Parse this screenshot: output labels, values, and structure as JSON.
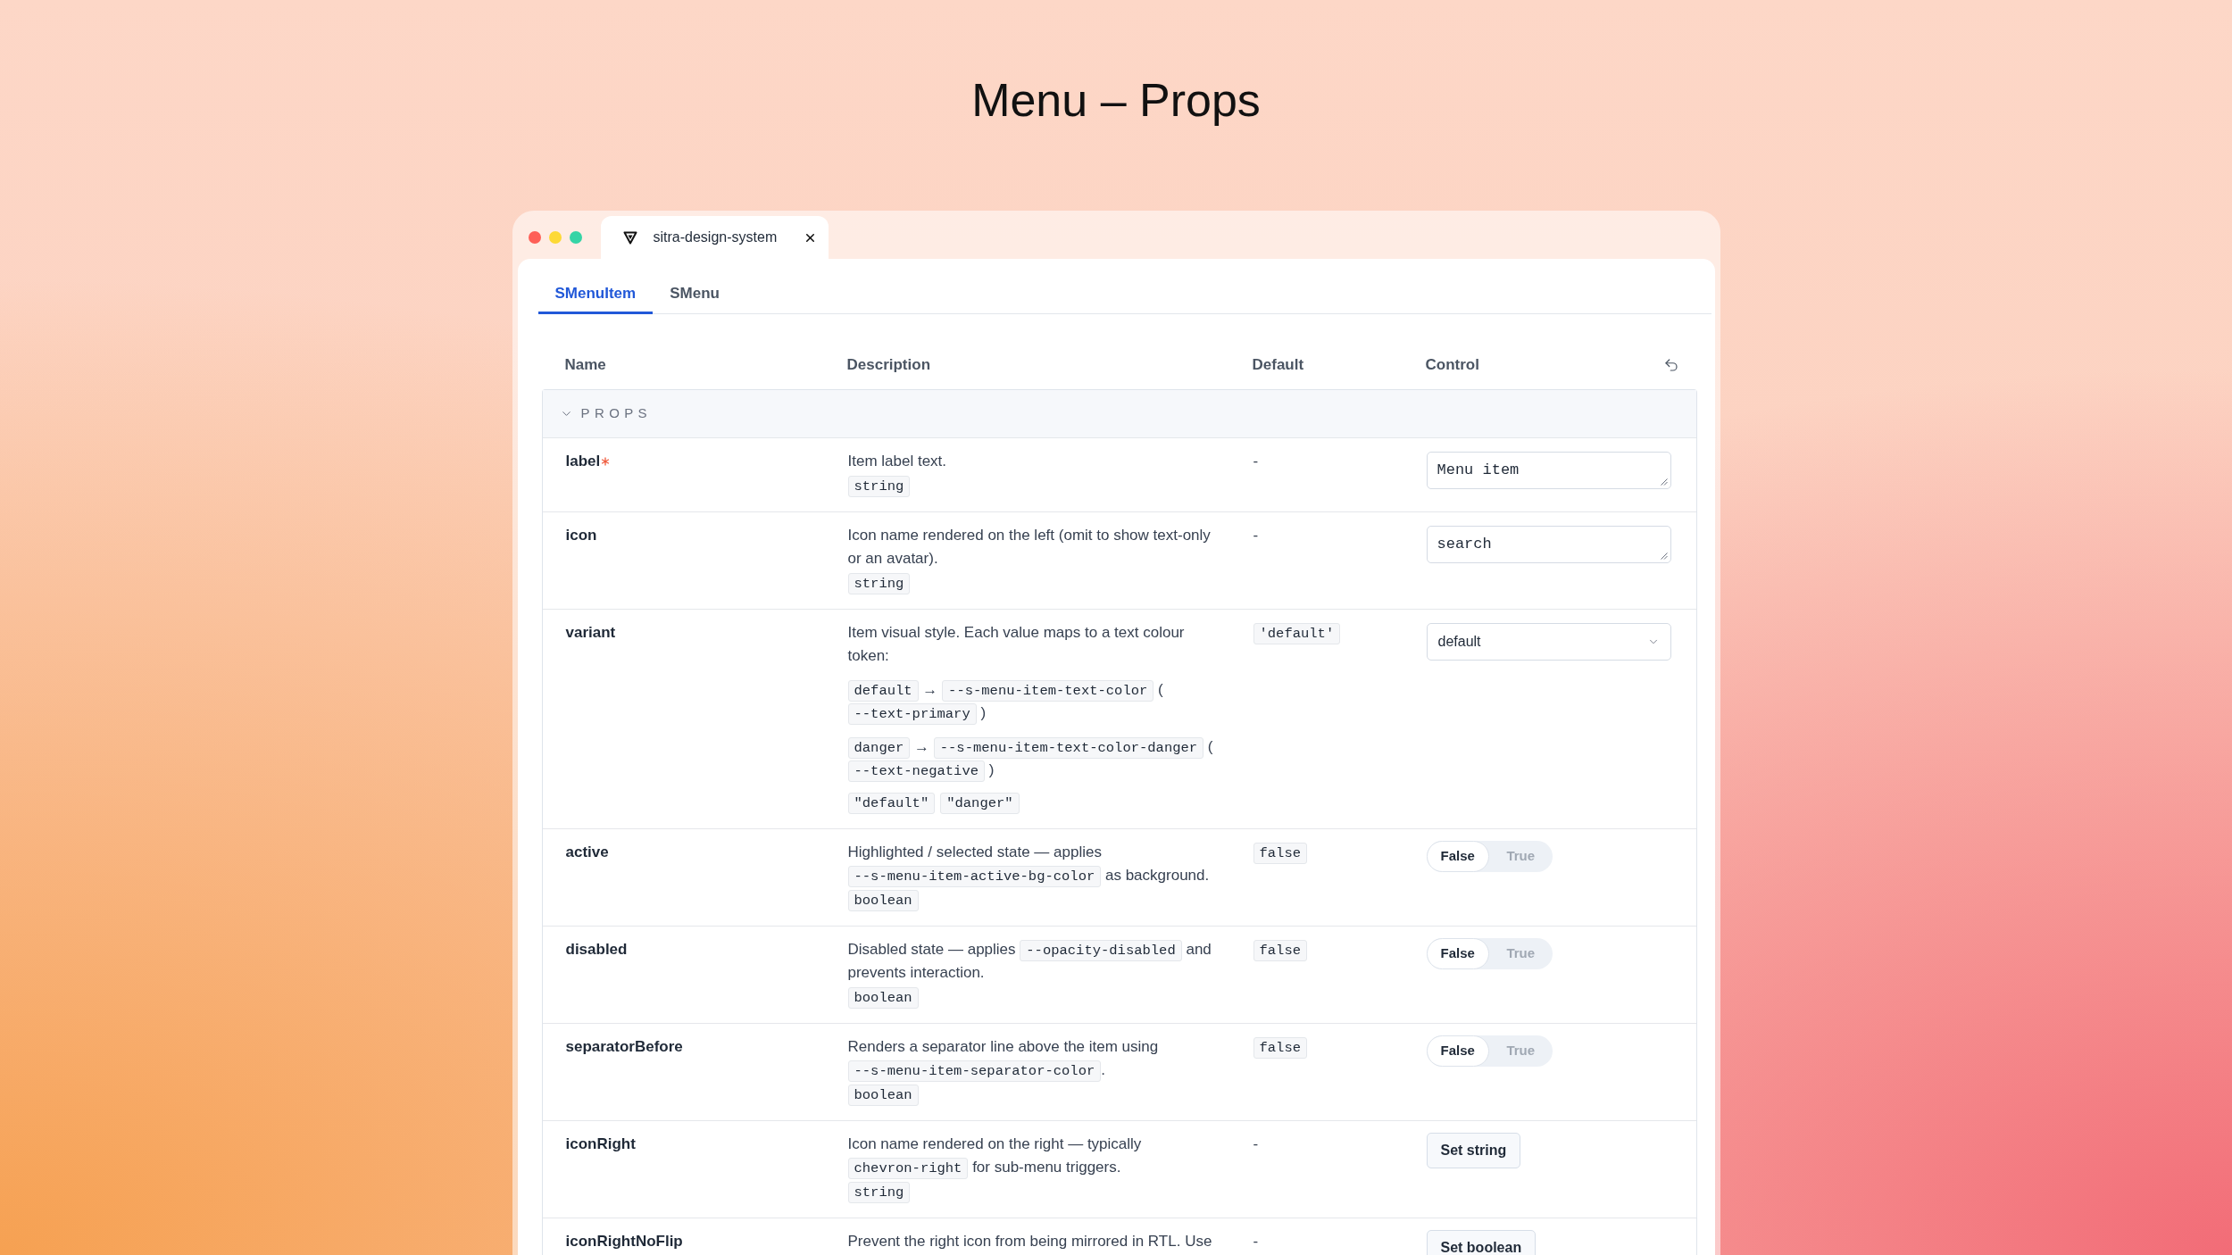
{
  "page_title": "Menu – Props",
  "browser_tab": {
    "title": "sitra-design-system"
  },
  "component_tabs": [
    {
      "label": "SMenuItem",
      "selected": true
    },
    {
      "label": "SMenu",
      "selected": false
    }
  ],
  "table": {
    "columns": [
      "Name",
      "Description",
      "Default",
      "Control"
    ],
    "section": {
      "title": "PROPS",
      "expanded": true
    },
    "rows": [
      {
        "name": "label",
        "required": true,
        "description": [
          {
            "kind": "text",
            "segments": [
              {
                "kind": "text",
                "text": "Item label text."
              }
            ]
          }
        ],
        "types": [
          "string"
        ],
        "default": {
          "kind": "text",
          "text": "-"
        },
        "control": {
          "kind": "textarea",
          "value": "Menu item"
        }
      },
      {
        "name": "icon",
        "required": false,
        "description": [
          {
            "kind": "text",
            "segments": [
              {
                "kind": "text",
                "text": "Icon name rendered on the left (omit to show text-only or an avatar)."
              }
            ]
          }
        ],
        "types": [
          "string"
        ],
        "default": {
          "kind": "text",
          "text": "-"
        },
        "control": {
          "kind": "textarea",
          "value": "search"
        }
      },
      {
        "name": "variant",
        "required": false,
        "description": [
          {
            "kind": "text",
            "segments": [
              {
                "kind": "text",
                "text": "Item visual style. Each value maps to a text colour token:"
              }
            ]
          },
          {
            "kind": "mapping",
            "segments": [
              {
                "kind": "code",
                "text": "default"
              },
              {
                "kind": "text",
                "text": " → "
              },
              {
                "kind": "code",
                "text": "--s-menu-item-text-color"
              },
              {
                "kind": "text",
                "text": " ( "
              },
              {
                "kind": "code",
                "text": "--text-primary"
              },
              {
                "kind": "text",
                "text": " )"
              }
            ]
          },
          {
            "kind": "mapping",
            "segments": [
              {
                "kind": "code",
                "text": "danger"
              },
              {
                "kind": "text",
                "text": " → "
              },
              {
                "kind": "code",
                "text": "--s-menu-item-text-color-danger"
              },
              {
                "kind": "text",
                "text": " ( "
              },
              {
                "kind": "code",
                "text": "--text-negative"
              },
              {
                "kind": "text",
                "text": " )"
              }
            ]
          }
        ],
        "types": [
          "\"default\"",
          "\"danger\""
        ],
        "default": {
          "kind": "code",
          "text": "'default'"
        },
        "control": {
          "kind": "select",
          "value": "default"
        }
      },
      {
        "name": "active",
        "required": false,
        "description": [
          {
            "kind": "text",
            "segments": [
              {
                "kind": "text",
                "text": "Highlighted / selected state — applies "
              },
              {
                "kind": "code",
                "text": "--s-menu-item-active-bg-color"
              },
              {
                "kind": "text",
                "text": " as background."
              }
            ]
          }
        ],
        "types": [
          "boolean"
        ],
        "default": {
          "kind": "code",
          "text": "false"
        },
        "control": {
          "kind": "toggle",
          "options": [
            {
              "label": "False",
              "selected": true
            },
            {
              "label": "True",
              "selected": false
            }
          ]
        }
      },
      {
        "name": "disabled",
        "required": false,
        "description": [
          {
            "kind": "text",
            "segments": [
              {
                "kind": "text",
                "text": "Disabled state — applies "
              },
              {
                "kind": "code",
                "text": "--opacity-disabled"
              },
              {
                "kind": "text",
                "text": " and prevents interaction."
              }
            ]
          }
        ],
        "types": [
          "boolean"
        ],
        "default": {
          "kind": "code",
          "text": "false"
        },
        "control": {
          "kind": "toggle",
          "options": [
            {
              "label": "False",
              "selected": true
            },
            {
              "label": "True",
              "selected": false
            }
          ]
        }
      },
      {
        "name": "separatorBefore",
        "required": false,
        "description": [
          {
            "kind": "text",
            "segments": [
              {
                "kind": "text",
                "text": "Renders a separator line above the item using "
              },
              {
                "kind": "code",
                "text": "--s-menu-item-separator-color"
              },
              {
                "kind": "text",
                "text": "."
              }
            ]
          }
        ],
        "types": [
          "boolean"
        ],
        "default": {
          "kind": "code",
          "text": "false"
        },
        "control": {
          "kind": "toggle",
          "options": [
            {
              "label": "False",
              "selected": true
            },
            {
              "label": "True",
              "selected": false
            }
          ]
        }
      },
      {
        "name": "iconRight",
        "required": false,
        "description": [
          {
            "kind": "text",
            "segments": [
              {
                "kind": "text",
                "text": "Icon name rendered on the right — typically "
              },
              {
                "kind": "code",
                "text": "chevron-right"
              },
              {
                "kind": "text",
                "text": " for sub-menu triggers."
              }
            ]
          }
        ],
        "types": [
          "string"
        ],
        "default": {
          "kind": "text",
          "text": "-"
        },
        "control": {
          "kind": "button",
          "label": "Set string"
        }
      },
      {
        "name": "iconRightNoFlip",
        "required": false,
        "description": [
          {
            "kind": "text",
            "segments": [
              {
                "kind": "text",
                "text": "Prevent the right icon from being mirrored in RTL. Use"
              }
            ]
          }
        ],
        "default": {
          "kind": "text",
          "text": "-"
        },
        "control": {
          "kind": "button",
          "label": "Set boolean"
        }
      }
    ]
  }
}
